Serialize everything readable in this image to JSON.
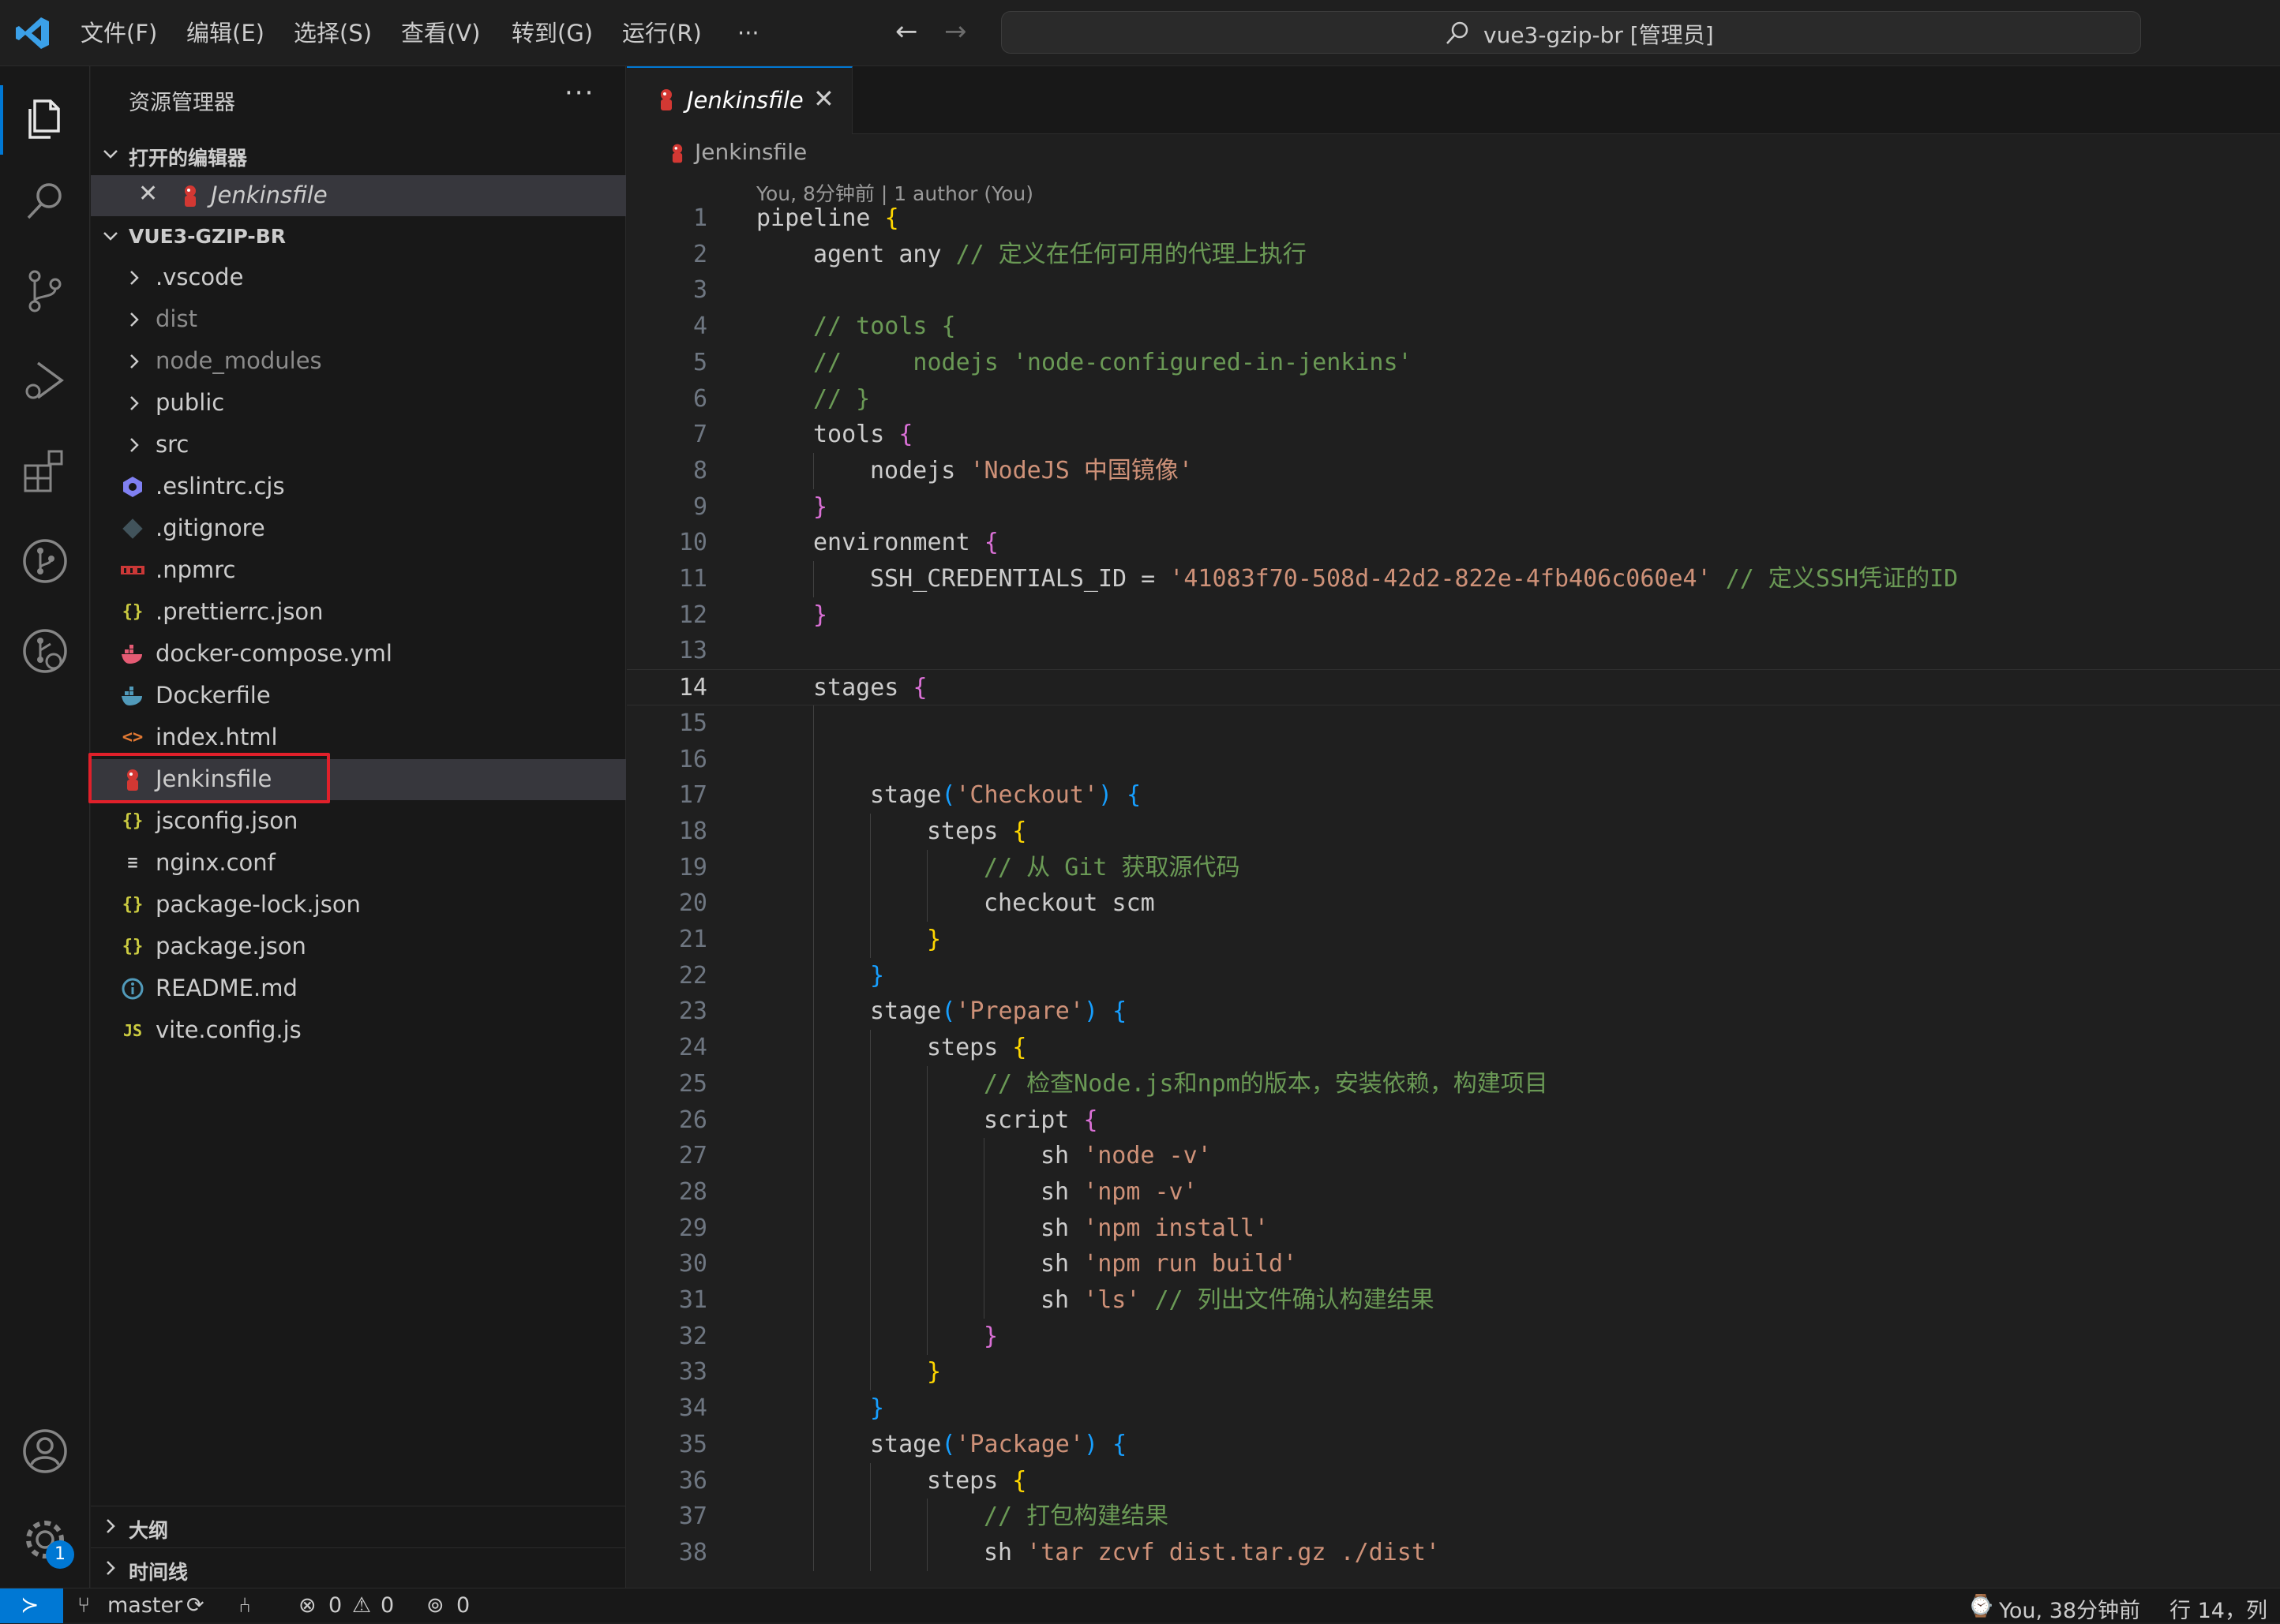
{
  "titlebar": {
    "menus": [
      "文件(F)",
      "编辑(E)",
      "选择(S)",
      "查看(V)",
      "转到(G)",
      "运行(R)",
      "···"
    ],
    "search_title": "vue3-gzip-br [管理员]"
  },
  "activity": {
    "items": [
      "explorer-icon",
      "search-icon",
      "source-control-icon",
      "run-debug-icon",
      "extensions-icon",
      "git-graph-icon",
      "git-remote-icon"
    ],
    "settings_badge": "1"
  },
  "sidebar": {
    "title": "资源管理器",
    "more": "···",
    "open_editors_title": "打开的编辑器",
    "open_editor_file": "Jenkinsfile",
    "project_title": "VUE3-GZIP-BR",
    "tree": [
      {
        "name": ".vscode",
        "type": "folder",
        "dim": false
      },
      {
        "name": "dist",
        "type": "folder",
        "dim": true
      },
      {
        "name": "node_modules",
        "type": "folder",
        "dim": true
      },
      {
        "name": "public",
        "type": "folder",
        "dim": false
      },
      {
        "name": "src",
        "type": "folder",
        "dim": false
      },
      {
        "name": ".eslintrc.cjs",
        "type": "eslint",
        "dim": false
      },
      {
        "name": ".gitignore",
        "type": "git",
        "dim": false
      },
      {
        "name": ".npmrc",
        "type": "npm",
        "dim": false
      },
      {
        "name": ".prettierrc.json",
        "type": "json",
        "dim": false
      },
      {
        "name": "docker-compose.yml",
        "type": "docker-compose",
        "dim": false
      },
      {
        "name": "Dockerfile",
        "type": "docker",
        "dim": false
      },
      {
        "name": "index.html",
        "type": "html",
        "dim": false
      },
      {
        "name": "Jenkinsfile",
        "type": "jenkins",
        "dim": false,
        "selected": true
      },
      {
        "name": "jsconfig.json",
        "type": "json",
        "dim": false
      },
      {
        "name": "nginx.conf",
        "type": "conf",
        "dim": false
      },
      {
        "name": "package-lock.json",
        "type": "json",
        "dim": false
      },
      {
        "name": "package.json",
        "type": "json",
        "dim": false
      },
      {
        "name": "README.md",
        "type": "info",
        "dim": false
      },
      {
        "name": "vite.config.js",
        "type": "js",
        "dim": false
      }
    ],
    "outline_title": "大纲",
    "timeline_title": "时间线"
  },
  "editor": {
    "tab_label": "Jenkinsfile",
    "breadcrumb": "Jenkinsfile",
    "codelens": "You, 8分钟前 | 1 author (You)",
    "current_line": 14,
    "lines": [
      {
        "n": "1",
        "indent": 0,
        "tokens": [
          [
            "pipeline ",
            "#cccccc"
          ],
          [
            "{",
            "#ffd700"
          ]
        ]
      },
      {
        "n": "2",
        "indent": 1,
        "tokens": [
          [
            "agent any ",
            "#cccccc"
          ],
          [
            "// 定义在任何可用的代理上执行",
            "#6a9955"
          ]
        ]
      },
      {
        "n": "3",
        "indent": 1,
        "tokens": []
      },
      {
        "n": "4",
        "indent": 1,
        "tokens": [
          [
            "// tools {",
            "#6a9955"
          ]
        ]
      },
      {
        "n": "5",
        "indent": 1,
        "tokens": [
          [
            "//     nodejs 'node-configured-in-jenkins'",
            "#6a9955"
          ]
        ]
      },
      {
        "n": "6",
        "indent": 1,
        "tokens": [
          [
            "// }",
            "#6a9955"
          ]
        ]
      },
      {
        "n": "7",
        "indent": 1,
        "tokens": [
          [
            "tools ",
            "#cccccc"
          ],
          [
            "{",
            "#da70d6"
          ]
        ]
      },
      {
        "n": "8",
        "indent": 2,
        "tokens": [
          [
            "nodejs ",
            "#cccccc"
          ],
          [
            "'NodeJS 中国镜像'",
            "#ce9178"
          ]
        ]
      },
      {
        "n": "9",
        "indent": 1,
        "tokens": [
          [
            "}",
            "#da70d6"
          ]
        ]
      },
      {
        "n": "10",
        "indent": 1,
        "tokens": [
          [
            "environment ",
            "#cccccc"
          ],
          [
            "{",
            "#da70d6"
          ]
        ]
      },
      {
        "n": "11",
        "indent": 2,
        "tokens": [
          [
            "SSH_CREDENTIALS_ID = ",
            "#cccccc"
          ],
          [
            "'41083f70-508d-42d2-822e-4fb406c060e4'",
            "#ce9178"
          ],
          [
            " // 定义SSH凭证的ID",
            "#6a9955"
          ]
        ]
      },
      {
        "n": "12",
        "indent": 1,
        "tokens": [
          [
            "}",
            "#da70d6"
          ]
        ]
      },
      {
        "n": "13",
        "indent": 1,
        "tokens": []
      },
      {
        "n": "14",
        "indent": 1,
        "tokens": [
          [
            "stages ",
            "#cccccc"
          ],
          [
            "{",
            "#da70d6"
          ]
        ]
      },
      {
        "n": "15",
        "indent": 2,
        "tokens": []
      },
      {
        "n": "16",
        "indent": 2,
        "tokens": []
      },
      {
        "n": "17",
        "indent": 2,
        "tokens": [
          [
            "stage",
            "#cccccc"
          ],
          [
            "(",
            "#179fff"
          ],
          [
            "'Checkout'",
            "#ce9178"
          ],
          [
            ") ",
            "#179fff"
          ],
          [
            "{",
            "#179fff"
          ]
        ]
      },
      {
        "n": "18",
        "indent": 3,
        "tokens": [
          [
            "steps ",
            "#cccccc"
          ],
          [
            "{",
            "#ffd700"
          ]
        ]
      },
      {
        "n": "19",
        "indent": 4,
        "tokens": [
          [
            "// 从 Git 获取源代码",
            "#6a9955"
          ]
        ]
      },
      {
        "n": "20",
        "indent": 4,
        "tokens": [
          [
            "checkout scm",
            "#cccccc"
          ]
        ]
      },
      {
        "n": "21",
        "indent": 3,
        "tokens": [
          [
            "}",
            "#ffd700"
          ]
        ]
      },
      {
        "n": "22",
        "indent": 2,
        "tokens": [
          [
            "}",
            "#179fff"
          ]
        ]
      },
      {
        "n": "23",
        "indent": 2,
        "tokens": [
          [
            "stage",
            "#cccccc"
          ],
          [
            "(",
            "#179fff"
          ],
          [
            "'Prepare'",
            "#ce9178"
          ],
          [
            ") ",
            "#179fff"
          ],
          [
            "{",
            "#179fff"
          ]
        ]
      },
      {
        "n": "24",
        "indent": 3,
        "tokens": [
          [
            "steps ",
            "#cccccc"
          ],
          [
            "{",
            "#ffd700"
          ]
        ]
      },
      {
        "n": "25",
        "indent": 4,
        "tokens": [
          [
            "// 检查Node.js和npm的版本，安装依赖，构建项目",
            "#6a9955"
          ]
        ]
      },
      {
        "n": "26",
        "indent": 4,
        "tokens": [
          [
            "script ",
            "#cccccc"
          ],
          [
            "{",
            "#da70d6"
          ]
        ]
      },
      {
        "n": "27",
        "indent": 5,
        "tokens": [
          [
            "sh ",
            "#cccccc"
          ],
          [
            "'node -v'",
            "#ce9178"
          ]
        ]
      },
      {
        "n": "28",
        "indent": 5,
        "tokens": [
          [
            "sh ",
            "#cccccc"
          ],
          [
            "'npm -v'",
            "#ce9178"
          ]
        ]
      },
      {
        "n": "29",
        "indent": 5,
        "tokens": [
          [
            "sh ",
            "#cccccc"
          ],
          [
            "'npm install'",
            "#ce9178"
          ]
        ]
      },
      {
        "n": "30",
        "indent": 5,
        "tokens": [
          [
            "sh ",
            "#cccccc"
          ],
          [
            "'npm run build'",
            "#ce9178"
          ]
        ]
      },
      {
        "n": "31",
        "indent": 5,
        "tokens": [
          [
            "sh ",
            "#cccccc"
          ],
          [
            "'ls'",
            "#ce9178"
          ],
          [
            " // 列出文件确认构建结果",
            "#6a9955"
          ]
        ]
      },
      {
        "n": "32",
        "indent": 4,
        "tokens": [
          [
            "}",
            "#da70d6"
          ]
        ]
      },
      {
        "n": "33",
        "indent": 3,
        "tokens": [
          [
            "}",
            "#ffd700"
          ]
        ]
      },
      {
        "n": "34",
        "indent": 2,
        "tokens": [
          [
            "}",
            "#179fff"
          ]
        ]
      },
      {
        "n": "35",
        "indent": 2,
        "tokens": [
          [
            "stage",
            "#cccccc"
          ],
          [
            "(",
            "#179fff"
          ],
          [
            "'Package'",
            "#ce9178"
          ],
          [
            ") ",
            "#179fff"
          ],
          [
            "{",
            "#179fff"
          ]
        ]
      },
      {
        "n": "36",
        "indent": 3,
        "tokens": [
          [
            "steps ",
            "#cccccc"
          ],
          [
            "{",
            "#ffd700"
          ]
        ]
      },
      {
        "n": "37",
        "indent": 4,
        "tokens": [
          [
            "// 打包构建结果",
            "#6a9955"
          ]
        ]
      },
      {
        "n": "38",
        "indent": 4,
        "tokens": [
          [
            "sh ",
            "#cccccc"
          ],
          [
            "'tar zcvf dist.tar.gz ./dist'",
            "#ce9178"
          ]
        ]
      }
    ]
  },
  "statusbar": {
    "branch": "master",
    "errors": "0",
    "warnings": "0",
    "ports": "0",
    "blame": "You, 38分钟前",
    "position": "行 14，列"
  },
  "colors": {
    "accent": "#0078d4",
    "highlight": "#e0202a",
    "jenkins": "#d33833"
  }
}
